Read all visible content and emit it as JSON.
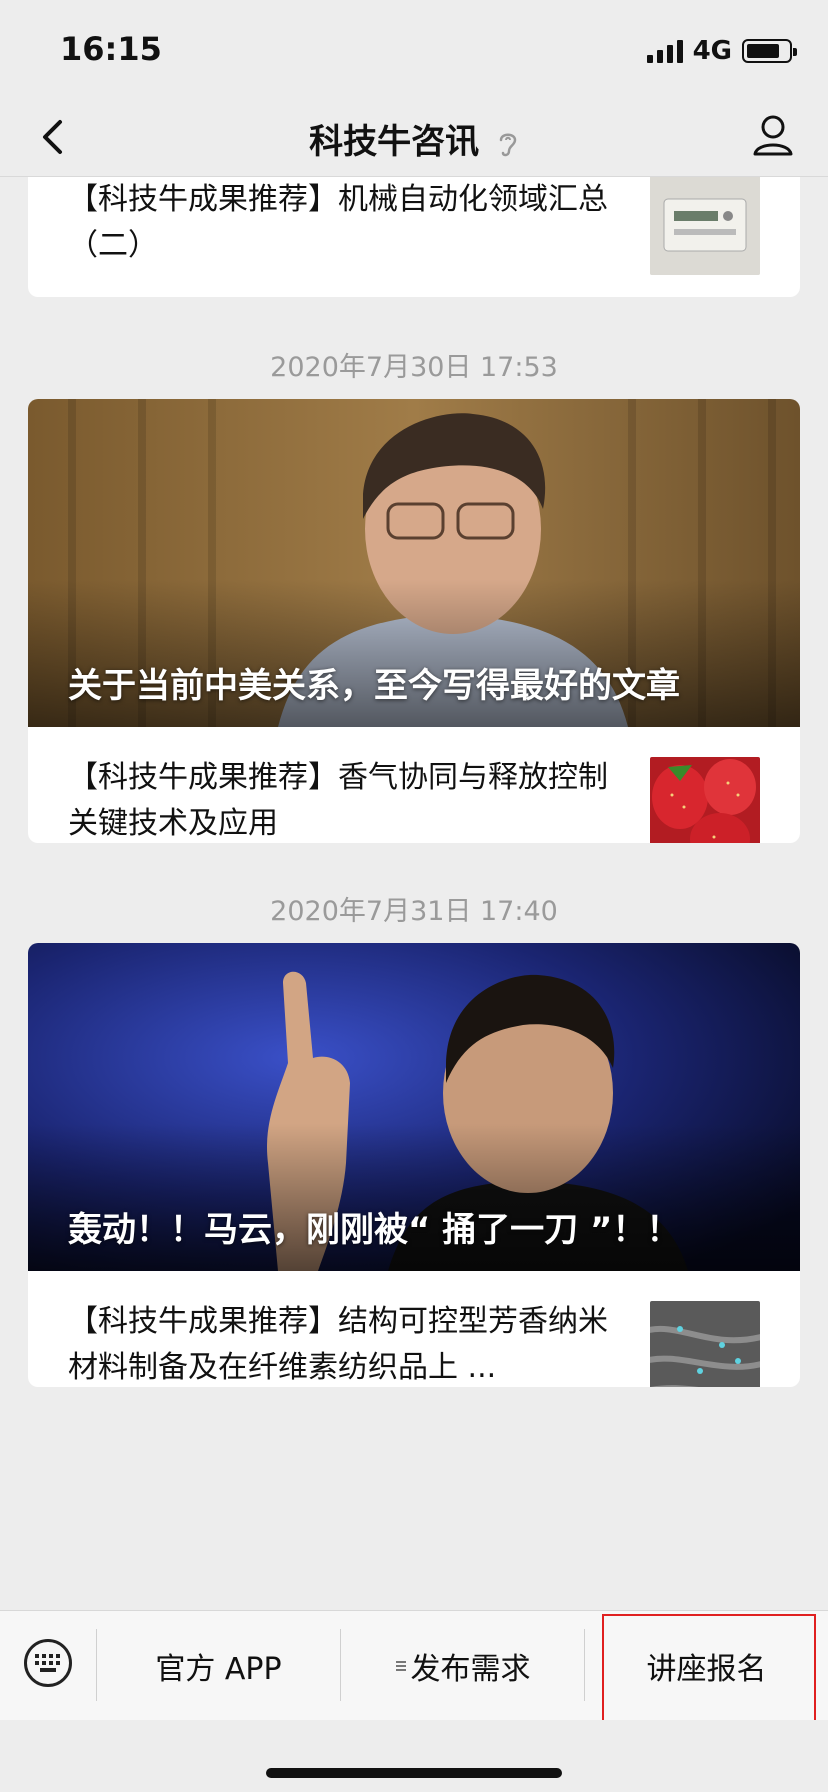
{
  "status_bar": {
    "time": "16:15",
    "network": "4G",
    "battery_level": 0.8
  },
  "nav": {
    "title": "科技牛咨讯"
  },
  "feed": {
    "top_item": {
      "title": "【科技牛成果推荐】机械自动化领域汇总（二）"
    },
    "groups": [
      {
        "timestamp": "2020年7月30日 17:53",
        "hero_title": "关于当前中美关系，至今写得最好的文章",
        "item_title": "【科技牛成果推荐】香气协同与释放控制关键技术及应用"
      },
      {
        "timestamp": "2020年7月31日 17:40",
        "hero_title": "轰动！！马云，刚刚被“ 捅了一刀 ”！！",
        "item_title": "【科技牛成果推荐】结构可控型芳香纳米材料制备及在纤维素纺织品上 ..."
      }
    ]
  },
  "menu": {
    "items": [
      {
        "label": "官方 APP"
      },
      {
        "label": "发布需求"
      },
      {
        "label": "讲座报名"
      }
    ]
  },
  "colors": {
    "highlight": "#e02020",
    "background": "#ededed"
  },
  "icons": {
    "back": "chevron-left-icon",
    "ear": "ear-icon",
    "profile": "person-icon",
    "keyboard": "keyboard-icon",
    "submenu": "menu-lines-icon"
  }
}
